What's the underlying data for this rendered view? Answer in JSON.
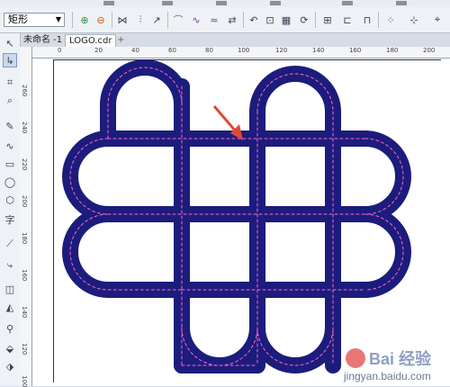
{
  "property_bar": {
    "shape_select_value": "矩形"
  },
  "tabs": [
    {
      "label": "未命名 -1"
    },
    {
      "label": "LOGO.cdr"
    },
    {
      "label": "+"
    }
  ],
  "rulers": {
    "horizontal": [
      "0",
      "20",
      "40",
      "60",
      "80",
      "100",
      "120",
      "140",
      "160",
      "180",
      "200"
    ],
    "vertical": [
      "260",
      "240",
      "220",
      "200",
      "180",
      "160",
      "140",
      "120",
      "100"
    ]
  },
  "drawing": {
    "fill_color": "#1c1c7c",
    "outline_color": "#1c1c7c",
    "path_color": "#ff66cc",
    "arrow_color": "#e0483a"
  },
  "watermark": {
    "brand": "Bai 经验",
    "url": "jingyan.baidu.com"
  }
}
